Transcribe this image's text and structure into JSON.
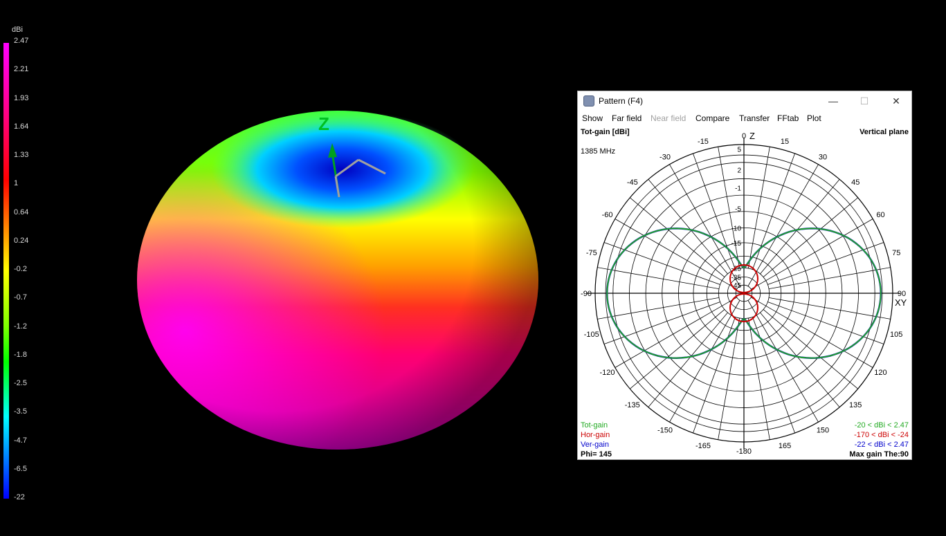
{
  "scale": {
    "unit": "dBi",
    "ticks": [
      "2.47",
      "2.21",
      "1.93",
      "1.64",
      "1.33",
      "1",
      "0.64",
      "0.24",
      "-0.2",
      "-0.7",
      "-1.2",
      "-1.8",
      "-2.5",
      "-3.5",
      "-4.7",
      "-6.5",
      "-22"
    ]
  },
  "scene": {
    "axis_label": "Z"
  },
  "window": {
    "title": "Pattern   (F4)",
    "controls": {
      "minimize": "—",
      "maximize": "☐",
      "close": "✕"
    },
    "menu": [
      {
        "label": "Show",
        "disabled": false
      },
      {
        "label": "Far field",
        "disabled": false
      },
      {
        "label": "Near field",
        "disabled": true
      },
      {
        "label": "Compare",
        "disabled": false
      },
      {
        "label": "Transfer",
        "disabled": false
      },
      {
        "label": "FFtab",
        "disabled": false
      },
      {
        "label": "Plot",
        "disabled": false
      }
    ],
    "plot_title": "Tot-gain [dBi]",
    "plane": "Vertical plane",
    "frequency": "1385 MHz",
    "axis_top": "Z",
    "axis_right": "XY",
    "angle_labels": [
      "0",
      "15",
      "30",
      "45",
      "60",
      "75",
      "90",
      "105",
      "120",
      "135",
      "150",
      "165",
      "-180",
      "-165",
      "-150",
      "-135",
      "-120",
      "-105",
      "-90",
      "-75",
      "-60",
      "-45",
      "-30",
      "-15"
    ],
    "ring_labels": [
      "5",
      "2",
      "-1",
      "-5",
      "-10",
      "-15",
      "-25",
      "-35",
      "-45"
    ],
    "legend": [
      {
        "name": "Tot-gain",
        "range": "-20 < dBi < 2.47",
        "color": "#22aa22"
      },
      {
        "name": "Hor-gain",
        "range": "-170 < dBi < -24",
        "color": "#cc0000"
      },
      {
        "name": "Ver-gain",
        "range": "-22 < dBi < 2.47",
        "color": "#0000cc"
      }
    ],
    "phi": "Phi= 145",
    "max_gain": "Max gain The:90"
  }
}
